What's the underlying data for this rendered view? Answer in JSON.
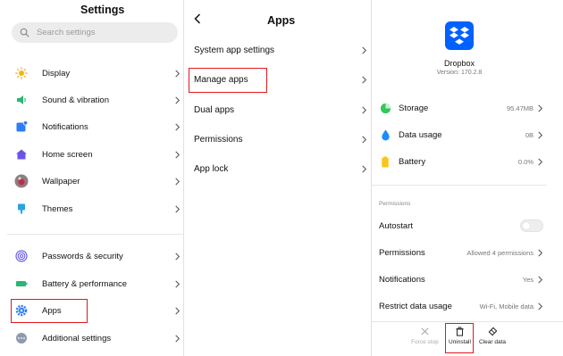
{
  "settings": {
    "title": "Settings",
    "search_placeholder": "Search settings",
    "items": [
      {
        "label": "Display"
      },
      {
        "label": "Sound & vibration"
      },
      {
        "label": "Notifications"
      },
      {
        "label": "Home screen"
      },
      {
        "label": "Wallpaper"
      },
      {
        "label": "Themes"
      },
      {
        "label": "Passwords & security"
      },
      {
        "label": "Battery & performance"
      },
      {
        "label": "Apps"
      },
      {
        "label": "Additional settings"
      }
    ],
    "highlighted_item": "Apps"
  },
  "apps": {
    "title": "Apps",
    "items": [
      {
        "label": "System app settings"
      },
      {
        "label": "Manage apps"
      },
      {
        "label": "Dual apps"
      },
      {
        "label": "Permissions"
      },
      {
        "label": "App lock"
      }
    ],
    "highlighted_item": "Manage apps"
  },
  "app_info": {
    "name": "Dropbox",
    "version": "Version: 170.2.8",
    "storage": {
      "label": "Storage",
      "value": "95.47MB"
    },
    "data_usage": {
      "label": "Data usage",
      "value": "0B"
    },
    "battery": {
      "label": "Battery",
      "value": "0.0%"
    },
    "permissions_section": "Permissions",
    "autostart": {
      "label": "Autostart",
      "enabled": false
    },
    "permissions": {
      "label": "Permissions",
      "value": "Allowed 4 permissions"
    },
    "notifications": {
      "label": "Notifications",
      "value": "Yes"
    },
    "restrict": {
      "label": "Restrict data usage",
      "value": "Wi-Fi, Mobile data"
    },
    "actions": {
      "force_stop": "Force stop",
      "uninstall": "Uninstall",
      "clear_data": "Clear data"
    },
    "highlighted_action": "Uninstall"
  },
  "colors": {
    "highlight": "#e0191c",
    "dropbox_blue": "#0061fe",
    "storage_green": "#34c759",
    "data_blue": "#1a8cff",
    "battery_yellow": "#f8c51c"
  }
}
